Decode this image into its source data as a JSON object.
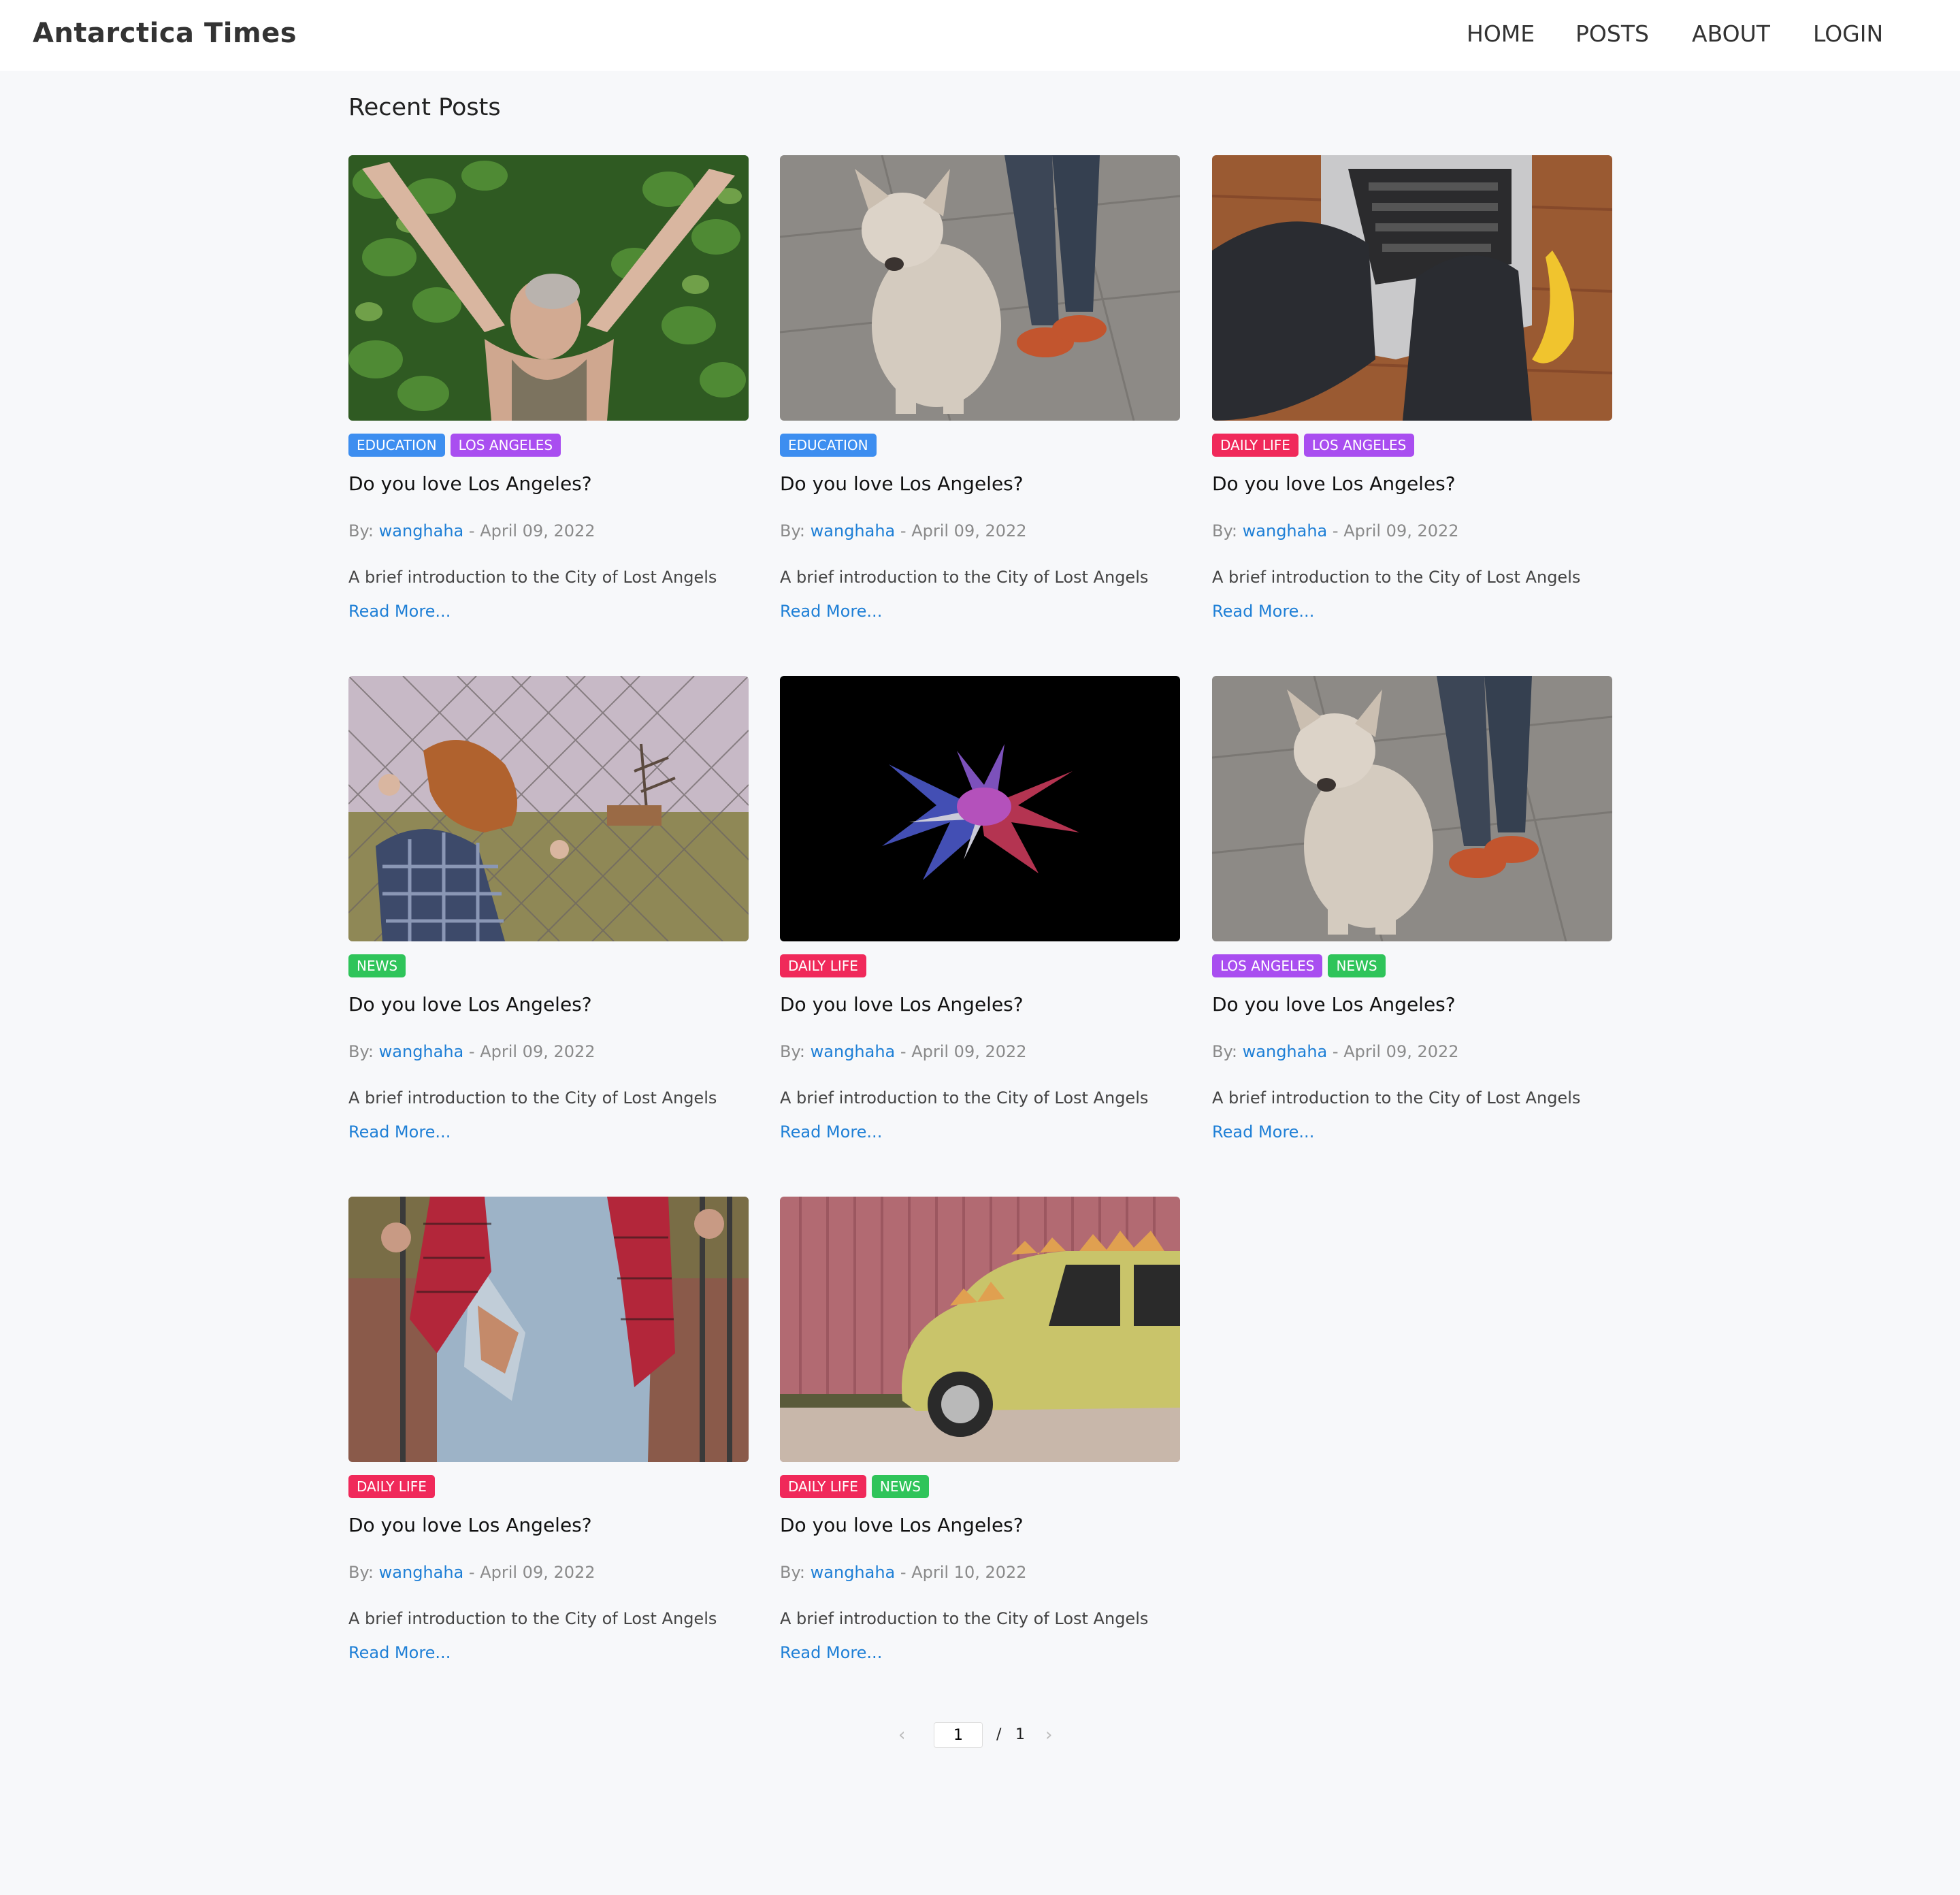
{
  "header": {
    "brand": "Antarctica Times",
    "nav": [
      "HOME",
      "POSTS",
      "ABOUT",
      "LOGIN"
    ]
  },
  "main": {
    "section_title": "Recent Posts",
    "by_label": "By: ",
    "date_sep": " - ",
    "read_more": "Read More...",
    "posts": [
      {
        "tags": [
          "EDUCATION",
          "LOS ANGELES"
        ],
        "title": "Do you love Los Angeles?",
        "author": "wanghaha",
        "date": "April 09, 2022",
        "excerpt": "A brief introduction to the City of Lost Angels"
      },
      {
        "tags": [
          "EDUCATION"
        ],
        "title": "Do you love Los Angeles?",
        "author": "wanghaha",
        "date": "April 09, 2022",
        "excerpt": "A brief introduction to the City of Lost Angels"
      },
      {
        "tags": [
          "DAILY LIFE",
          "LOS ANGELES"
        ],
        "title": "Do you love Los Angeles?",
        "author": "wanghaha",
        "date": "April 09, 2022",
        "excerpt": "A brief introduction to the City of Lost Angels"
      },
      {
        "tags": [
          "NEWS"
        ],
        "title": "Do you love Los Angeles?",
        "author": "wanghaha",
        "date": "April 09, 2022",
        "excerpt": "A brief introduction to the City of Lost Angels"
      },
      {
        "tags": [
          "DAILY LIFE"
        ],
        "title": "Do you love Los Angeles?",
        "author": "wanghaha",
        "date": "April 09, 2022",
        "excerpt": "A brief introduction to the City of Lost Angels"
      },
      {
        "tags": [
          "LOS ANGELES",
          "NEWS"
        ],
        "title": "Do you love Los Angeles?",
        "author": "wanghaha",
        "date": "April 09, 2022",
        "excerpt": "A brief introduction to the City of Lost Angels"
      },
      {
        "tags": [
          "DAILY LIFE"
        ],
        "title": "Do you love Los Angeles?",
        "author": "wanghaha",
        "date": "April 09, 2022",
        "excerpt": "A brief introduction to the City of Lost Angels"
      },
      {
        "tags": [
          "DAILY LIFE",
          "NEWS"
        ],
        "title": "Do you love Los Angeles?",
        "author": "wanghaha",
        "date": "April 10, 2022",
        "excerpt": "A brief introduction to the City of Lost Angels"
      }
    ]
  },
  "pagination": {
    "prev_icon": "chevron-left-icon",
    "next_icon": "chevron-right-icon",
    "current_page": "1",
    "separator": "/",
    "total_pages": "1"
  },
  "colors": {
    "education": "#3d8ef0",
    "los_angeles": "#a94ef0",
    "daily_life": "#f0295a",
    "news": "#2fc45a",
    "link": "#1e7fd6",
    "page_bg": "#f7f8fa"
  }
}
